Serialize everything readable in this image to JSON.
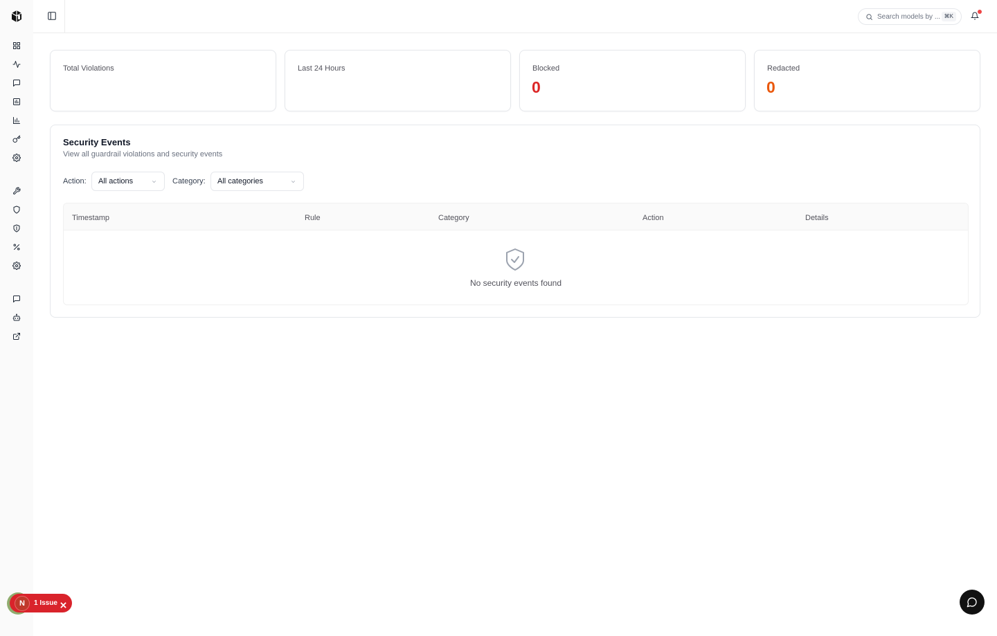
{
  "topbar": {
    "search_placeholder": "Search models by ...",
    "search_shortcut": "⌘K"
  },
  "stats": [
    {
      "label": "Total Violations",
      "value": ""
    },
    {
      "label": "Last 24 Hours",
      "value": ""
    },
    {
      "label": "Blocked",
      "value": "0",
      "color": "#dc2626"
    },
    {
      "label": "Redacted",
      "value": "0",
      "color": "#ea580c"
    }
  ],
  "events": {
    "title": "Security Events",
    "subtitle": "View all guardrail violations and security events",
    "action_filter_label": "Action:",
    "action_filter_value": "All actions",
    "category_filter_label": "Category:",
    "category_filter_value": "All categories",
    "columns": [
      "Timestamp",
      "Rule",
      "Category",
      "Action",
      "Details"
    ],
    "empty_text": "No security events found"
  },
  "issue_badge": {
    "letter": "N",
    "text": "1 Issue"
  },
  "sidebar_icons": [
    "dashboard-icon",
    "activity-icon",
    "chat-icon",
    "bar-chart-icon",
    "chart-icon",
    "key-icon",
    "settings-icon",
    "wrench-icon",
    "shield-icon",
    "shield-half-icon",
    "percent-icon",
    "gear-icon",
    "message-icon",
    "bot-icon",
    "external-link-icon"
  ]
}
